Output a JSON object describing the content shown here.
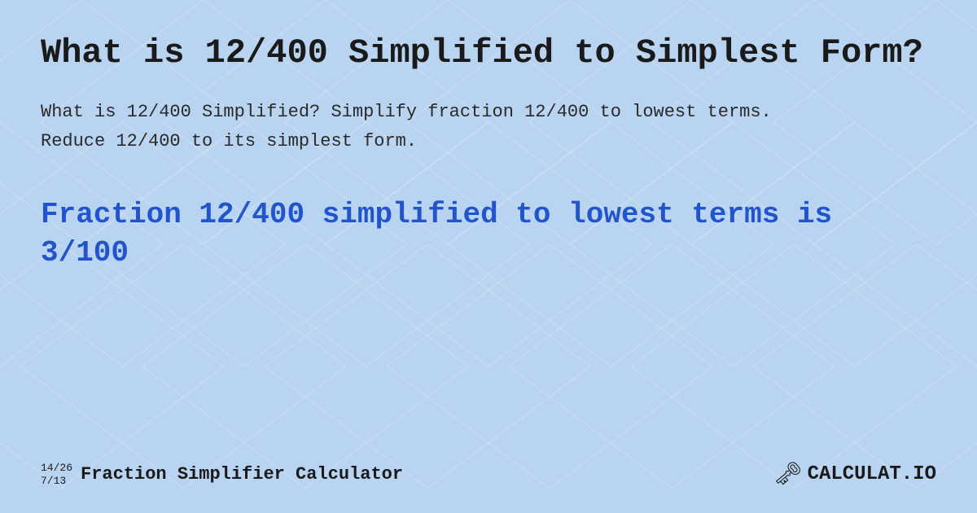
{
  "background": {
    "color": "#b8d4f0"
  },
  "main_title": "What is 12/400 Simplified to Simplest Form?",
  "description": "What is 12/400 Simplified? Simplify fraction 12/400 to lowest terms. Reduce 12/400 to its simplest form.",
  "result_title": "Fraction 12/400 simplified to lowest terms is 3/100",
  "footer": {
    "fraction_top": "14/26",
    "fraction_bottom": "7/13",
    "brand_label": "Fraction Simplifier Calculator",
    "logo_text": "CALCULAT.IO"
  }
}
